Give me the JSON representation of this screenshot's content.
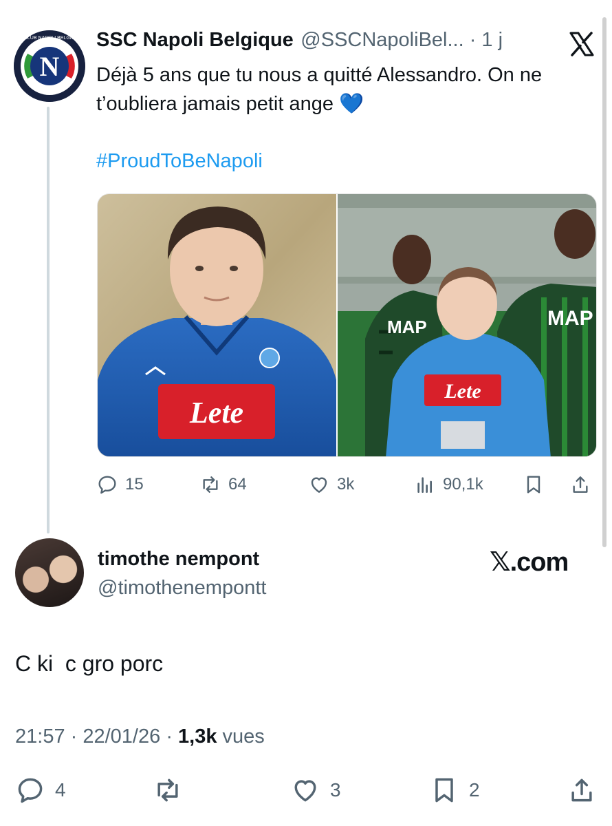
{
  "quoted_tweet": {
    "avatar_logo_letter": "N",
    "avatar_ring_text": "CLUB NAPOLI BELGIO",
    "display_name": "SSC Napoli Belgique",
    "handle_time": "@SSCNapoliBel... · 1 j",
    "text": "Déjà 5 ans que tu nous a quitté Alessandro. On ne t’oubliera jamais petit ange 💙",
    "hashtag": "#ProudToBeNapoli",
    "media": {
      "left_photo_jersey_text": "Lete",
      "right_photo_jersey_text": "Lete",
      "right_photo_kit_text": "MAP"
    },
    "actions": {
      "replies": "15",
      "reposts": "64",
      "likes": "3k",
      "views": "90,1k"
    }
  },
  "reply_tweet": {
    "display_name": "timothe nempont",
    "handle": "@timothenempontt",
    "watermark": "𝕏.com",
    "text": "C ki  c gro porc",
    "time": "21:57",
    "date": "22/01/26",
    "views_count": "1,3k",
    "views_label": "vues",
    "actions": {
      "replies": "4",
      "reposts": "",
      "likes": "3",
      "bookmarks": "2"
    }
  },
  "colors": {
    "text": "#0f1419",
    "secondary": "#536471",
    "link": "#1d9bf0",
    "napoli_blue": "#1a5fb4",
    "lete_red": "#d8202a"
  }
}
